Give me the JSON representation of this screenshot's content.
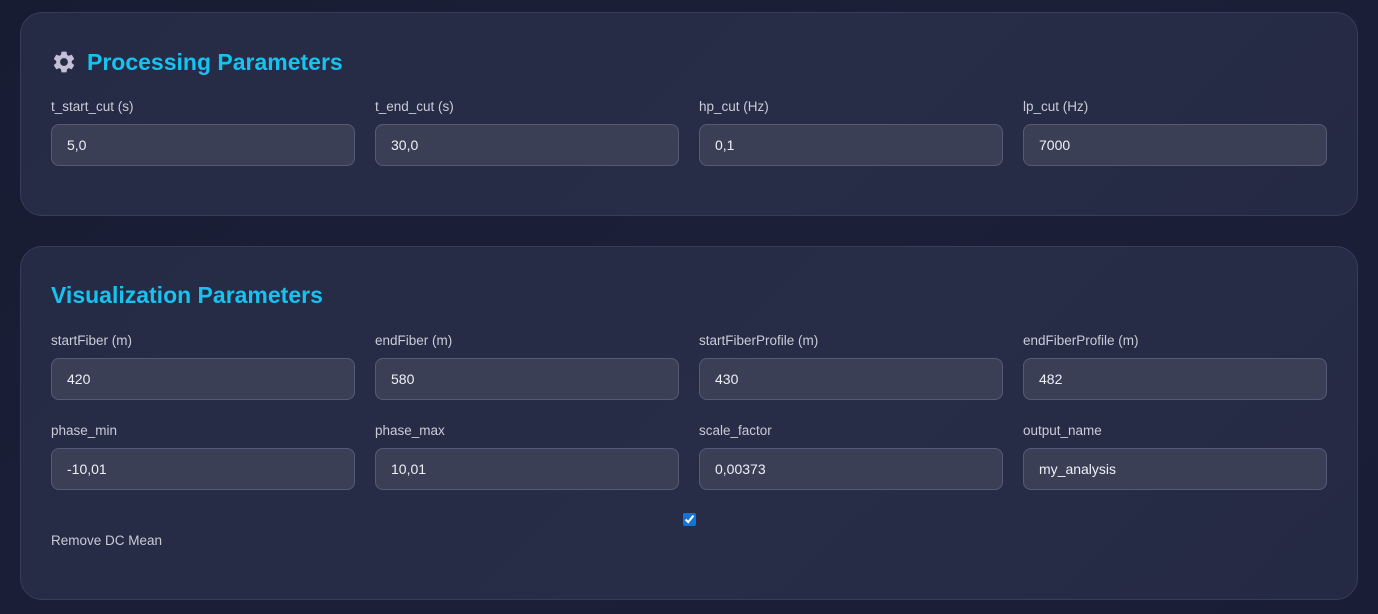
{
  "processing": {
    "title": "Processing Parameters",
    "icon": "gear-icon",
    "fields": [
      {
        "label": "t_start_cut (s)",
        "value": "5,0"
      },
      {
        "label": "t_end_cut (s)",
        "value": "30,0"
      },
      {
        "label": "hp_cut (Hz)",
        "value": "0,1"
      },
      {
        "label": "lp_cut (Hz)",
        "value": "7000"
      }
    ]
  },
  "visualization": {
    "title": "Visualization Parameters",
    "row1": [
      {
        "label": "startFiber (m)",
        "value": "420"
      },
      {
        "label": "endFiber (m)",
        "value": "580"
      },
      {
        "label": "startFiberProfile (m)",
        "value": "430"
      },
      {
        "label": "endFiberProfile (m)",
        "value": "482"
      }
    ],
    "row2": [
      {
        "label": "phase_min",
        "value": "-10,01"
      },
      {
        "label": "phase_max",
        "value": "10,01"
      },
      {
        "label": "scale_factor",
        "value": "0,00373"
      },
      {
        "label": "output_name",
        "value": "my_analysis"
      }
    ],
    "remove_dc": {
      "label": "Remove DC Mean",
      "checked": true
    }
  },
  "colors": {
    "accent": "#17c2f0",
    "background": "#1b1f38",
    "panel": "#272c47",
    "input_bg": "#3a3f56",
    "checkbox": "#1473d6"
  }
}
